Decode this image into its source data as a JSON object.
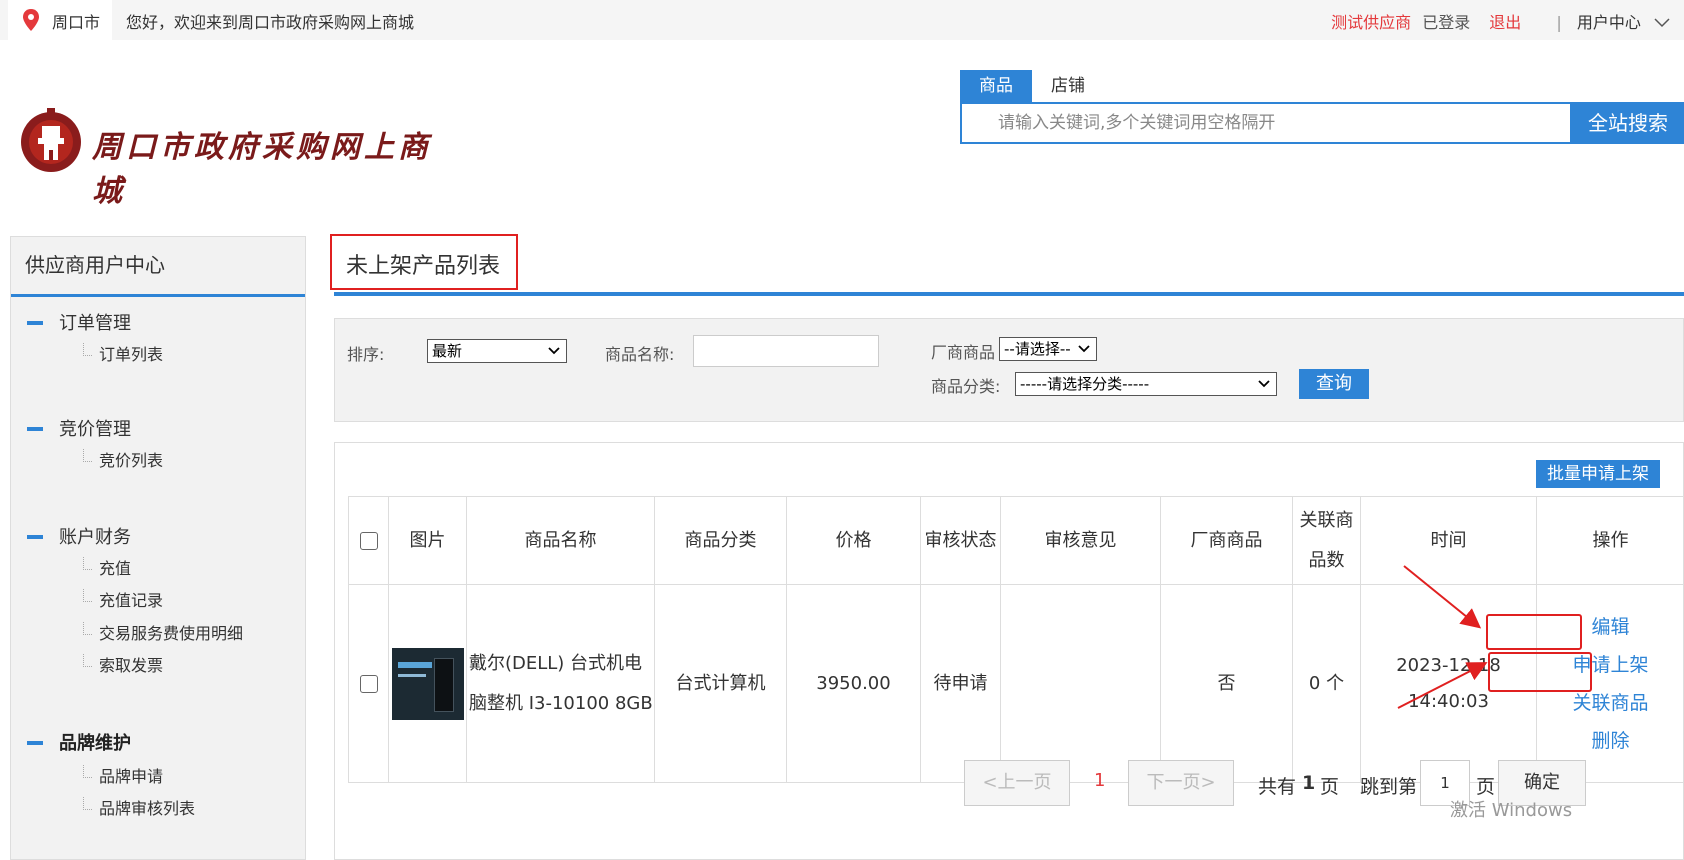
{
  "topbar": {
    "city": "周口市",
    "welcome": "您好，欢迎来到周口市政府采购网上商城",
    "supplier": "测试供应商",
    "logged_in": "已登录",
    "logout": "退出",
    "separator": "|",
    "user_center": "用户中心"
  },
  "logo": {
    "text": "周口市政府采购网上商城"
  },
  "search": {
    "tabs": [
      "商品",
      "店铺"
    ],
    "placeholder": "请输入关键词,多个关键词用空格隔开",
    "button": "全站搜索"
  },
  "sidebar": {
    "title": "供应商用户中心",
    "groups": [
      {
        "label": "订单管理",
        "items": [
          "订单列表"
        ]
      },
      {
        "label": "竞价管理",
        "items": [
          "竞价列表"
        ]
      },
      {
        "label": "账户财务",
        "items": [
          "充值",
          "充值记录",
          "交易服务费使用明细",
          "索取发票"
        ]
      },
      {
        "label": "品牌维护",
        "items": [
          "品牌申请",
          "品牌审核列表"
        ]
      }
    ]
  },
  "main": {
    "title": "未上架产品列表",
    "filter": {
      "sort_label": "排序:",
      "sort_value": "最新",
      "name_label": "商品名称:",
      "vendor_label": "厂商商品",
      "vendor_value": "--请选择--",
      "category_label": "商品分类:",
      "category_value": "-----请选择分类-----",
      "query_button": "查询"
    },
    "batch_button": "批量申请上架",
    "table": {
      "headers": [
        "图片",
        "商品名称",
        "商品分类",
        "价格",
        "审核状态",
        "审核意见",
        "厂商商品",
        "关联商品数",
        "时间",
        "操作"
      ],
      "rows": [
        {
          "name": "戴尔(DELL) 台式机电脑整机 I3-10100 8GB",
          "category": "台式计算机",
          "price": "3950.00",
          "status": "待申请",
          "opinion": "",
          "vendor": "否",
          "related": "0 个",
          "time": "2023-12-18 14:40:03",
          "actions": [
            "编辑",
            "申请上架",
            "关联商品",
            "删除"
          ]
        }
      ]
    },
    "pagination": {
      "prev": "<上一页",
      "current": "1",
      "next": "下一页>",
      "total_prefix": "共有",
      "total_num": "1",
      "total_suffix": "页",
      "jump_label": "跳到第",
      "jump_value": "1",
      "jump_suffix": "页",
      "confirm": "确定"
    }
  },
  "watermark": "激活 Windows",
  "colors": {
    "accent": "#2e84d6",
    "highlight": "#e02020",
    "alert_text": "#e4393c"
  }
}
